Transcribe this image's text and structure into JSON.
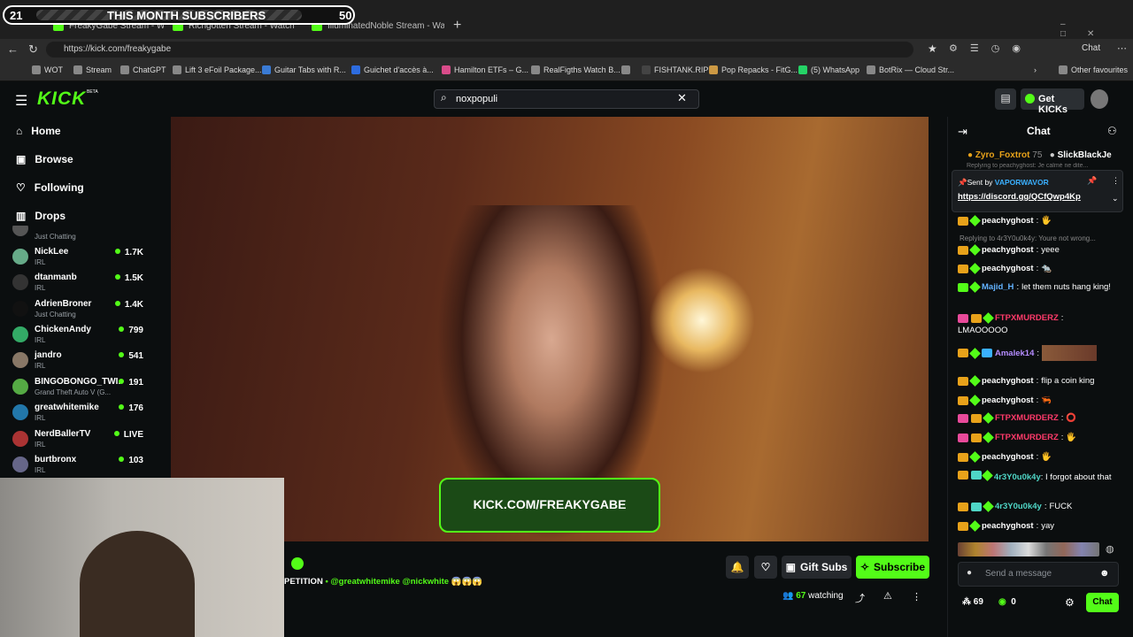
{
  "overlay": {
    "left": "21",
    "title": "THIS MONTH SUBSCRIBERS",
    "right": "50"
  },
  "browser": {
    "tabs": [
      "FreakyGabe Stream - Watch",
      "Richgotten Stream - Watch",
      "IlluminatedNoble Stream - Wa"
    ],
    "url": "https://kick.com/freakygabe",
    "bookmarks": [
      "WOT",
      "Stream",
      "ChatGPT",
      "Lift 3 eFoil Package...",
      "Guitar Tabs with R...",
      "Guichet d'accès à...",
      "Hamilton ETFs – G...",
      "RealFigths Watch B...",
      "FISHTANK.RIP",
      "Pop Repacks - FitG...",
      "(5) WhatsApp",
      "BotRix — Cloud Str..."
    ],
    "other_favourites": "Other favourites",
    "copilot": "Chat"
  },
  "header": {
    "logo": "KICK",
    "logo_tag": "BETA",
    "search_value": "noxpopuli",
    "get_kicks": "Get KICKs"
  },
  "nav": [
    {
      "label": "Home",
      "icon": "home-icon"
    },
    {
      "label": "Browse",
      "icon": "browse-icon"
    },
    {
      "label": "Following",
      "icon": "heart-icon"
    },
    {
      "label": "Drops",
      "icon": "drops-icon"
    }
  ],
  "channels": [
    {
      "name": "",
      "cat": "Just Chatting",
      "viewers": ""
    },
    {
      "name": "NickLee",
      "cat": "IRL",
      "viewers": "1.7K"
    },
    {
      "name": "dtanmanb",
      "cat": "IRL",
      "viewers": "1.5K"
    },
    {
      "name": "AdrienBroner",
      "cat": "Just Chatting",
      "viewers": "1.4K"
    },
    {
      "name": "ChickenAndy",
      "cat": "IRL",
      "viewers": "799"
    },
    {
      "name": "jandro",
      "cat": "IRL",
      "viewers": "541"
    },
    {
      "name": "BINGOBONGO_TWI...",
      "cat": "Grand Theft Auto V (G...",
      "viewers": "191"
    },
    {
      "name": "greatwhitemike",
      "cat": "IRL",
      "viewers": "176"
    },
    {
      "name": "NerdBallerTV",
      "cat": "IRL",
      "viewers": "LIVE"
    },
    {
      "name": "burtbronx",
      "cat": "IRL",
      "viewers": "103"
    }
  ],
  "video": {
    "banner": "KICK.COM/FREAKYGABE"
  },
  "stream_info": {
    "title_tail": "PETITION",
    "mentions": "• @greatwhitemike @nickwhite 😱😱😱",
    "watching_count": "67",
    "watching_label": "watching",
    "gift_subs": "Gift Subs",
    "subscribe": "Subscribe"
  },
  "chat": {
    "title": "Chat",
    "gifters": [
      {
        "name": "Zyro_Foxtrot",
        "count": "75"
      },
      {
        "name": "SlickBlackJe",
        "count": ""
      }
    ],
    "reply_top": "Replying to peachyghost: Je calmé ne dite...",
    "pinned": {
      "sent_by": "Sent by",
      "user": "VAPORWAVOR",
      "link": "https://discord.gg/QCfQwp4Kp"
    },
    "messages": [
      {
        "user": "peachyghost",
        "text": "",
        "color": "#ffffff"
      },
      {
        "reply": "Replying to 4r3Y0u0k4y: Youre not wrong..."
      },
      {
        "user": "peachyghost",
        "text": "yeee",
        "color": "#ffffff"
      },
      {
        "user": "peachyghost",
        "text": "",
        "color": "#ffffff"
      },
      {
        "user": "Majid_H",
        "text": "let them nuts hang king!",
        "color": "#63b3ff"
      },
      {
        "user": "FTPXMURDERZ",
        "text": "LMAOOOOO",
        "color": "#ff3a6a"
      },
      {
        "user": "Amalek14",
        "text": "",
        "color": "#b58cff"
      },
      {
        "user": "peachyghost",
        "text": "flip a coin king",
        "color": "#ffffff"
      },
      {
        "user": "peachyghost",
        "text": "",
        "color": "#ffffff"
      },
      {
        "user": "FTPXMURDERZ",
        "text": "",
        "color": "#ff3a6a"
      },
      {
        "user": "FTPXMURDERZ",
        "text": "",
        "color": "#ff3a6a"
      },
      {
        "user": "peachyghost",
        "text": "",
        "color": "#ffffff"
      },
      {
        "user": "4r3Y0u0k4y",
        "text": "I forgot about that",
        "color": "#4fd6c6"
      },
      {
        "user": "4r3Y0u0k4y",
        "text": "FUCK",
        "color": "#4fd6c6"
      },
      {
        "user": "peachyghost",
        "text": "yay",
        "color": "#ffffff"
      }
    ],
    "placeholder": "Send a message",
    "points": "69",
    "kicks": "0",
    "send": "Chat"
  },
  "colors": {
    "kick_green": "#53fc18",
    "bg": "#0b0e0f"
  }
}
